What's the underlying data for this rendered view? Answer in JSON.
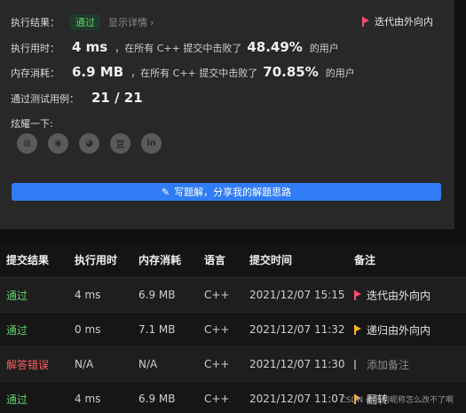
{
  "result": {
    "label": "执行结果：",
    "status": "通过",
    "details": "显示详情",
    "chevron": "›",
    "note": "迭代由外向内",
    "note_flag_color": "#ff4d6a"
  },
  "runtime": {
    "label": "执行用时：",
    "value": "4 ms",
    "middle": "，在所有 C++ 提交中击败了",
    "percent": "48.49%",
    "suffix": "的用户"
  },
  "memory": {
    "label": "内存消耗：",
    "value": "6.9 MB",
    "middle": "，在所有 C++ 提交中击败了",
    "percent": "70.85%",
    "suffix": "的用户"
  },
  "tests": {
    "label": "通过测试用例：",
    "value": "21 / 21"
  },
  "share": {
    "label": "炫耀一下:",
    "icons": [
      "wechat-icon",
      "weibo-icon",
      "qq-icon",
      "douban-icon",
      "linkedin-icon"
    ],
    "glyphs": [
      "◍",
      "◉",
      "◕",
      "豆",
      "in"
    ]
  },
  "write_button": {
    "label": "写题解，分享我的解题思路"
  },
  "table": {
    "headers": [
      "提交结果",
      "执行用时",
      "内存消耗",
      "语言",
      "提交时间",
      "备注"
    ],
    "rows": [
      {
        "result": "通过",
        "time": "4 ms",
        "memory": "6.9 MB",
        "lang": "C++",
        "date": "2021/12/07 15:15",
        "note": "迭代由外向内",
        "flag_color": "#ff4d6a"
      },
      {
        "result": "通过",
        "time": "0 ms",
        "memory": "7.1 MB",
        "lang": "C++",
        "date": "2021/12/07 11:32",
        "note": "递归由外向内",
        "flag_color": "#ffb020"
      },
      {
        "result": "解答错误",
        "time": "N/A",
        "memory": "N/A",
        "lang": "C++",
        "date": "2021/12/07 11:30",
        "note": "添加备注",
        "flag_color": "#8a8a8a"
      },
      {
        "result": "通过",
        "time": "4 ms",
        "memory": "6.9 MB",
        "lang": "C++",
        "date": "2021/12/07 11:07",
        "note": "翻转",
        "flag_color": "#ffb020"
      }
    ]
  },
  "watermark": "CSDN @我的昵称怎么改不了啊"
}
